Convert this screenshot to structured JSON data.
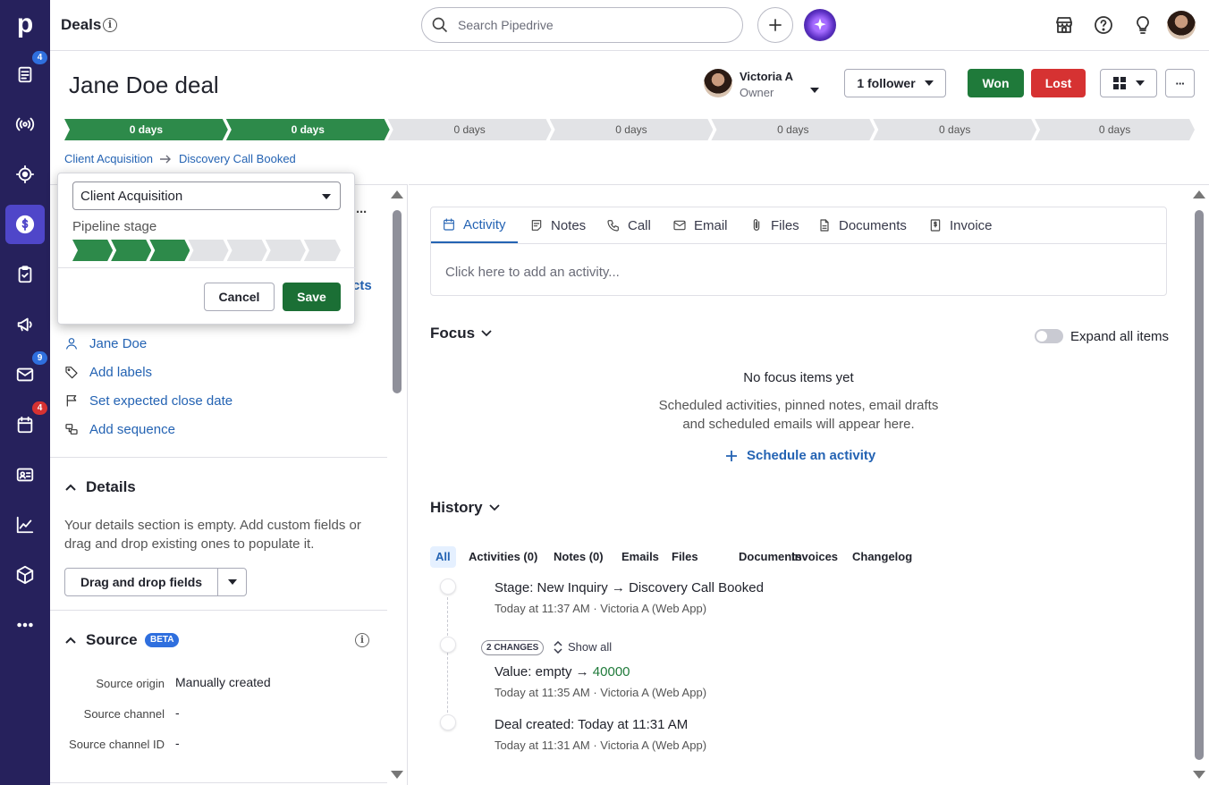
{
  "app": {
    "logo": "p"
  },
  "sidebar": {
    "items": [
      {
        "name": "leads",
        "badge": "4",
        "badge_color": "#2f6fde"
      },
      {
        "name": "campaigns-broadcast",
        "badge": null
      },
      {
        "name": "focus",
        "badge": null
      },
      {
        "name": "deals",
        "badge": null,
        "active": true
      },
      {
        "name": "activities",
        "badge": null
      },
      {
        "name": "marketing",
        "badge": null
      },
      {
        "name": "mail",
        "badge": "9",
        "badge_color": "#2f6fde"
      },
      {
        "name": "calendar",
        "badge": "4",
        "badge_color": "#d63232"
      },
      {
        "name": "contacts",
        "badge": null
      },
      {
        "name": "insights",
        "badge": null
      },
      {
        "name": "products",
        "badge": null
      },
      {
        "name": "more",
        "badge": null
      }
    ]
  },
  "topbar": {
    "title": "Deals",
    "info_glyph": "i",
    "search_placeholder": "Search Pipedrive"
  },
  "deal": {
    "title": "Jane Doe deal",
    "owner_name": "Victoria A",
    "owner_role": "Owner",
    "follower_label": "1 follower",
    "won_label": "Won",
    "lost_label": "Lost",
    "more_label": "···"
  },
  "stages": [
    {
      "label": "0 days",
      "done": true
    },
    {
      "label": "0 days",
      "done": true
    },
    {
      "label": "0 days",
      "done": false
    },
    {
      "label": "0 days",
      "done": false
    },
    {
      "label": "0 days",
      "done": false
    },
    {
      "label": "0 days",
      "done": false
    },
    {
      "label": "0 days",
      "done": false
    }
  ],
  "breadcrumb": {
    "pipeline": "Client Acquisition",
    "stage": "Discovery Call Booked"
  },
  "popup": {
    "pipeline_value": "Client Acquisition",
    "stage_label": "Pipeline stage",
    "stage_index": 3,
    "stage_count": 7,
    "cancel_label": "Cancel",
    "save_label": "Save"
  },
  "left": {
    "more_dots": "···",
    "partial_link": "cts",
    "person_link": "Jane Doe",
    "labels_link": "Add labels",
    "close_date_link": "Set expected close date",
    "sequence_link": "Add sequence",
    "details_heading": "Details",
    "details_empty": "Your details section is empty. Add custom fields or drag and drop existing ones to populate it.",
    "drag_drop_label": "Drag and drop fields",
    "source_heading": "Source",
    "source_badge": "BETA",
    "source_rows": [
      {
        "label": "Source origin",
        "value": "Manually created"
      },
      {
        "label": "Source channel",
        "value": "-"
      },
      {
        "label": "Source channel ID",
        "value": "-"
      }
    ]
  },
  "main": {
    "tabs": [
      {
        "label": "Activity",
        "icon": "calendar-icon",
        "active": true
      },
      {
        "label": "Notes",
        "icon": "note-icon"
      },
      {
        "label": "Call",
        "icon": "phone-icon"
      },
      {
        "label": "Email",
        "icon": "mail-icon"
      },
      {
        "label": "Files",
        "icon": "paperclip-icon"
      },
      {
        "label": "Documents",
        "icon": "document-icon"
      },
      {
        "label": "Invoice",
        "icon": "invoice-icon"
      }
    ],
    "activity_placeholder": "Click here to add an activity...",
    "focus_heading": "Focus",
    "expand_label": "Expand all items",
    "no_focus_title": "No focus items yet",
    "no_focus_line1": "Scheduled activities, pinned notes, email drafts",
    "no_focus_line2": "and scheduled emails will appear here.",
    "schedule_label": "Schedule an activity",
    "history_heading": "History",
    "history_tabs": [
      "All",
      "Activities (0)",
      "Notes (0)",
      "Emails",
      "Files",
      "Documents",
      "Invoices",
      "Changelog"
    ],
    "history": [
      {
        "prefix": "Stage",
        "text": ": New Inquiry → Discovery Call Booked",
        "meta": "Today at 11:37 AM · Victoria A (Web App)"
      },
      {
        "changes_badge": "2 CHANGES",
        "show_all": "Show all",
        "prefix": "Value",
        "text": ": empty → ",
        "highlight": "40000",
        "highlight_color": "#1f7a3a",
        "meta": "Today at 11:35 AM · Victoria A (Web App)"
      },
      {
        "prefix": "Deal created",
        "text": ": Today at 11:31 AM",
        "meta": "Today at 11:31 AM · Victoria A (Web App)"
      }
    ]
  },
  "colors": {
    "sidebar_bg": "#26215c",
    "sidebar_active": "#4f46c9",
    "green": "#1f7a3a",
    "red": "#d63232",
    "link": "#2463b3"
  }
}
